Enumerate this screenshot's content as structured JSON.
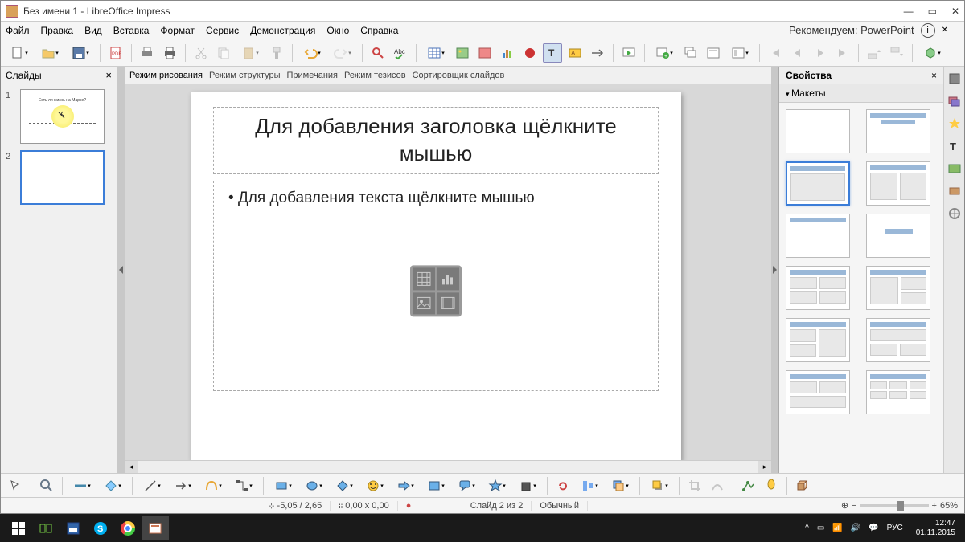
{
  "title": "Без имени 1 - LibreOffice Impress",
  "menu": [
    "Файл",
    "Правка",
    "Вид",
    "Вставка",
    "Формат",
    "Сервис",
    "Демонстрация",
    "Окно",
    "Справка"
  ],
  "recommend": "Рекомендуем: PowerPoint",
  "slides_panel": {
    "title": "Слайды"
  },
  "view_tabs": [
    "Режим рисования",
    "Режим структуры",
    "Примечания",
    "Режим тезисов",
    "Сортировщик слайдов"
  ],
  "slide": {
    "title_placeholder": "Для добавления заголовка щёлкните мышью",
    "body_placeholder": "Для добавления текста щёлкните мышью"
  },
  "thumb1_title": "Есть ли жизнь на Марсе?",
  "properties": {
    "title": "Свойства",
    "section": "Макеты"
  },
  "status": {
    "coords1": "-5,05 / 2,65",
    "coords2": "0,00 x 0,00",
    "slide_info": "Слайд 2 из 2",
    "mode": "Обычный",
    "zoom": "65%"
  },
  "taskbar": {
    "time": "12:47",
    "date": "01.11.2015",
    "lang": "РУС"
  }
}
